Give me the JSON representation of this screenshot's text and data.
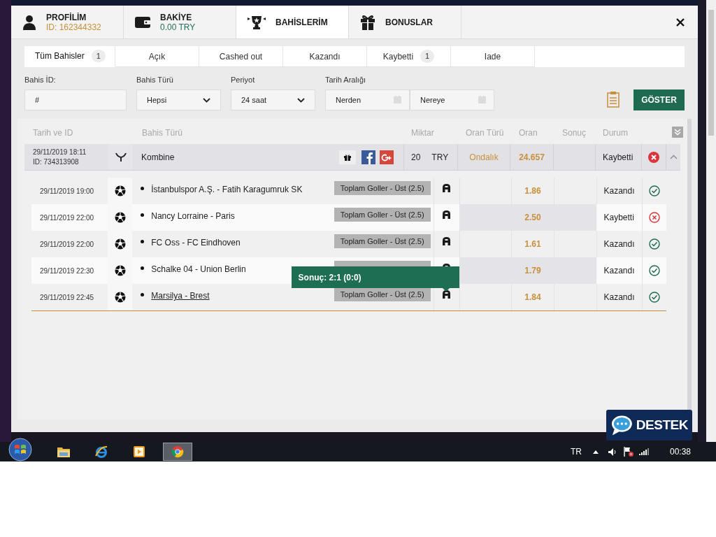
{
  "tabs": [
    {
      "kind": "profile",
      "label": "PROFİLİM",
      "sub": "ID: 162344332",
      "selected": false
    },
    {
      "kind": "wallet",
      "label": "BAKİYE",
      "sub": "0.00 TRY",
      "selected": false
    },
    {
      "kind": "trophy",
      "label": "BAHİSLERİM",
      "selected": true
    },
    {
      "kind": "gift",
      "label": "BONUSLAR",
      "selected": false
    }
  ],
  "filter_tabs": [
    {
      "label": "Tüm Bahisler",
      "count": "1",
      "selected": true
    },
    {
      "label": "Açık",
      "selected": false
    },
    {
      "label": "Cashed out",
      "selected": false
    },
    {
      "label": "Kazandı",
      "selected": false
    },
    {
      "label": "Kaybetti",
      "count": "1",
      "selected": false
    },
    {
      "label": "Iade",
      "selected": false
    }
  ],
  "filters": {
    "bet_id": {
      "label": "Bahis İD:",
      "value": "#"
    },
    "bet_type": {
      "label": "Bahis Türü",
      "value": "Hepsi"
    },
    "period": {
      "label": "Periyot",
      "value": "24 saat"
    },
    "date_range": {
      "label": "Tarih Aralığı",
      "from_placeholder": "Nerden",
      "to_placeholder": "Nereye"
    },
    "show_button": "GÖSTER"
  },
  "table": {
    "columns": [
      "Tarih ve ID",
      "Bahis Türü",
      "Miktar",
      "Oran Türü",
      "Oran",
      "Sonuç",
      "Durum"
    ],
    "bet": {
      "date": "29/11/2019 18:11",
      "id": "ID: 734313908",
      "type": "Kombine",
      "amount": "20",
      "currency": "TRY",
      "odds_type": "Ondalık",
      "odds": "24.657",
      "status": "Kaybetti",
      "won": false,
      "expanded": true,
      "selections": [
        {
          "date": "29/11/2019 19:00",
          "match": "İstanbulspor A.Ş. - Fatih Karagumruk SK",
          "market": "Toplam Goller - Üst (2.5)",
          "odds": "1.86",
          "status": "Kazandı",
          "won": true,
          "link": false
        },
        {
          "date": "29/11/2019 22:00",
          "match": "Nancy Lorraine - Paris",
          "market": "Toplam Goller - Üst (2.5)",
          "odds": "2.50",
          "status": "Kaybetti",
          "won": false,
          "link": false
        },
        {
          "date": "29/11/2019 22:00",
          "match": "FC Oss - FC Eindhoven",
          "market": "Toplam Goller - Üst (2.5)",
          "odds": "1.61",
          "status": "Kazandı",
          "won": true,
          "link": false
        },
        {
          "date": "29/11/2019 22:30",
          "match": "Schalke 04 - Union Berlin",
          "odds": "1.79",
          "status": "Kazandı",
          "won": true,
          "link": false
        },
        {
          "date": "29/11/2019 22:45",
          "match": "Marsilya - Brest",
          "market": "Toplam Goller - Üst (2.5)",
          "odds": "1.84",
          "status": "Kazandı",
          "won": true,
          "link": true,
          "tooltip": "Sonuç: 2:1 (0:0)"
        }
      ]
    }
  },
  "support_button": "DESTEK",
  "taskbar": {
    "language": "TR",
    "time": "00:38"
  }
}
